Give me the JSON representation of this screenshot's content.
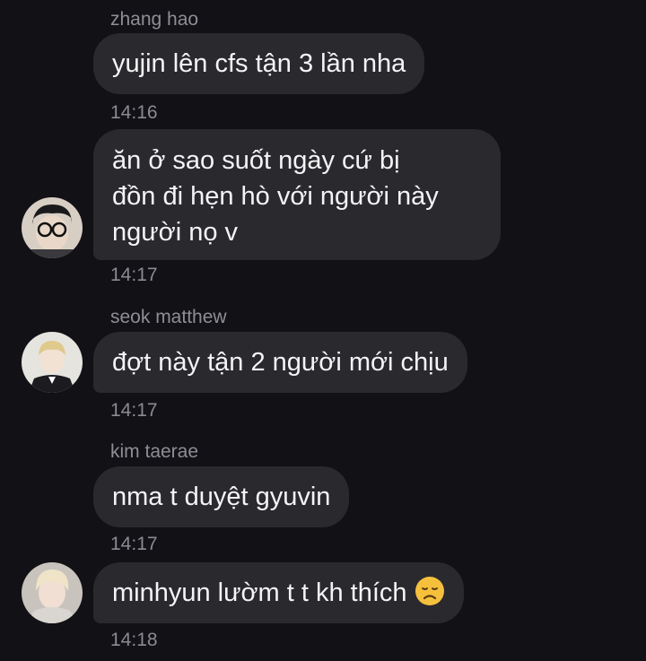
{
  "messages": [
    {
      "sender": "zhang hao",
      "text": "yujin lên cfs tận 3 lần nha",
      "time": "14:16"
    },
    {
      "line1": "ăn ở sao suốt ngày cứ bị",
      "line2": "đồn đi hẹn hò với người này",
      "line3": "người nọ v",
      "time": "14:17"
    },
    {
      "sender": "seok matthew",
      "text": "đợt này tận 2 người mới chịu",
      "time": "14:17"
    },
    {
      "sender": "kim taerae",
      "text": "nma t duyệt gyuvin",
      "time": "14:17"
    },
    {
      "text": "minhyun lườm t t kh thích",
      "emoji": "disappointed-face-emoji",
      "time": "14:18"
    }
  ],
  "colors": {
    "background": "#121116",
    "bubble": "#2a292e",
    "text": "#f4f4f6",
    "meta": "#8e8e96",
    "emoji": "#f6c03d"
  }
}
